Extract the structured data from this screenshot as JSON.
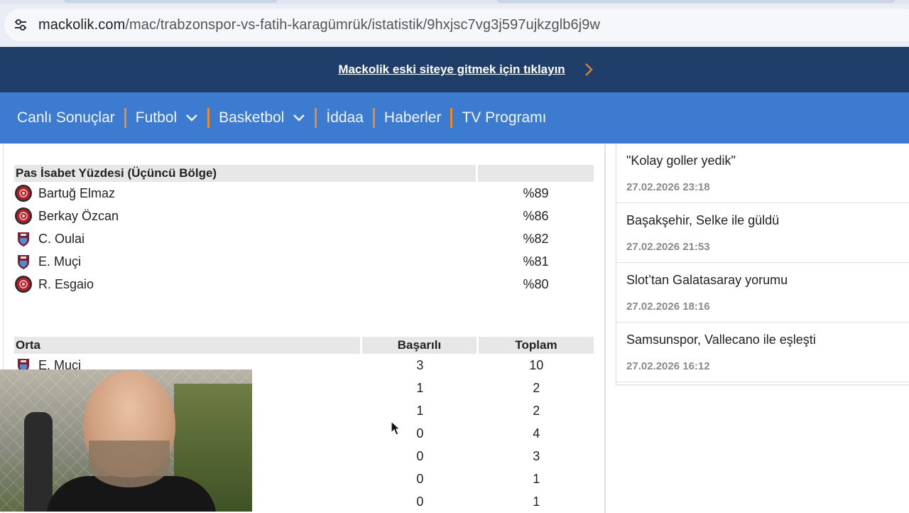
{
  "browser": {
    "url_domain": "mackolik.com",
    "url_path": "/mac/trabzonspor-vs-fatih-karagümrük/istatistik/9hxjsc7vg3j597ujkzglb6j9w"
  },
  "banner": {
    "link_text": "Mackolik eski siteye gitmek için tıklayın"
  },
  "nav": {
    "items": [
      {
        "label": "Canlı Sonuçlar"
      },
      {
        "label": "Futbol"
      },
      {
        "label": "Basketbol"
      },
      {
        "label": "İddaa"
      },
      {
        "label": "Haberler"
      },
      {
        "label": "TV Programı"
      }
    ]
  },
  "pass_accuracy": {
    "title": "Pas İsabet Yüzdesi (Üçüncü Bölge)",
    "rows": [
      {
        "player": "Bartuğ Elmaz",
        "value": "%89",
        "club": "karagumruk"
      },
      {
        "player": "Berkay Özcan",
        "value": "%86",
        "club": "karagumruk"
      },
      {
        "player": "C. Oulai",
        "value": "%82",
        "club": "trabzonspor"
      },
      {
        "player": "E. Muçi",
        "value": "%81",
        "club": "trabzonspor"
      },
      {
        "player": "R. Esgaio",
        "value": "%80",
        "club": "karagumruk"
      }
    ]
  },
  "orta": {
    "title": "Orta",
    "col_success": "Başarılı",
    "col_total": "Toplam",
    "rows": [
      {
        "player": "E. Muçi",
        "success": "3",
        "total": "10",
        "club": "trabzonspor"
      },
      {
        "player": "",
        "success": "1",
        "total": "2"
      },
      {
        "player": "",
        "success": "1",
        "total": "2"
      },
      {
        "player": "",
        "success": "0",
        "total": "4"
      },
      {
        "player": "",
        "success": "0",
        "total": "3"
      },
      {
        "player": "",
        "success": "0",
        "total": "1"
      },
      {
        "player": "",
        "success": "0",
        "total": "1"
      }
    ]
  },
  "news": [
    {
      "title": "\"Kolay goller yedik\"",
      "time": "27.02.2026 23:18"
    },
    {
      "title": "Başakşehir, Selke ile güldü",
      "time": "27.02.2026 21:53"
    },
    {
      "title": "Slot’tan Galatasaray yorumu",
      "time": "27.02.2026 18:16"
    },
    {
      "title": "Samsunspor, Vallecano ile eşleşti",
      "time": "27.02.2026 16:12"
    }
  ],
  "colors": {
    "banner_bg": "#1f3f6a",
    "nav_bg": "#3d7bd0",
    "nav_separator": "#e88a2e",
    "header_row_bg": "#e7e7e7",
    "karagumruk_red": "#b3202a",
    "trabzonspor_claret": "#7b1f3a",
    "trabzonspor_blue": "#4f8fd1"
  },
  "icons": {
    "site_settings": "tune-icon",
    "banner_arrow": "chevron-right-icon",
    "dropdown": "chevron-down-icon",
    "cursor": "mouse-pointer-icon"
  }
}
